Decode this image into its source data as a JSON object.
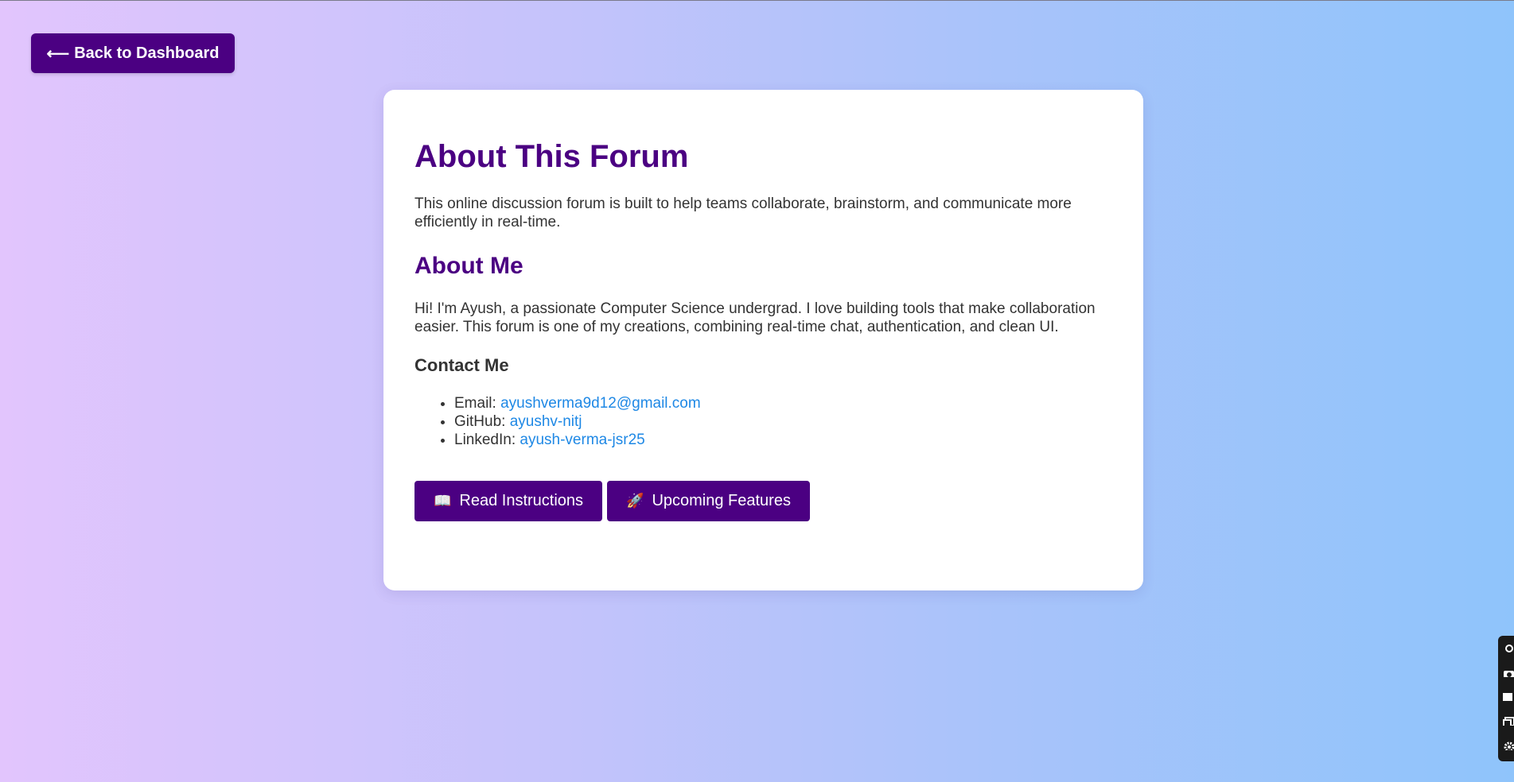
{
  "nav": {
    "back_arrow": "⟵",
    "back_label": "Back to Dashboard"
  },
  "about": {
    "title": "About This Forum",
    "description": "This online discussion forum is built to help teams collaborate, brainstorm, and communicate more efficiently in real-time.",
    "me_heading": "About Me",
    "bio": "Hi! I'm Ayush, a passionate Computer Science undergrad. I love building tools that make collaboration easier. This forum is one of my creations, combining real-time chat, authentication, and clean UI.",
    "contact_heading": "Contact Me",
    "contacts": [
      {
        "label": "Email:",
        "value": "ayushverma9d12@gmail.com"
      },
      {
        "label": "GitHub:",
        "value": "ayushv-nitj"
      },
      {
        "label": "LinkedIn:",
        "value": "ayush-verma-jsr25"
      }
    ]
  },
  "actions": {
    "read": {
      "icon": "📖",
      "label": "Read Instructions"
    },
    "upcoming": {
      "icon": "🚀",
      "label": "Upcoming Features"
    }
  },
  "colors": {
    "accent": "#4b0082",
    "link": "#1e88e5",
    "text": "#333333"
  },
  "toolbar_icons": [
    "link-icon",
    "camera-icon",
    "square-icon",
    "window-icon",
    "gear-icon"
  ]
}
